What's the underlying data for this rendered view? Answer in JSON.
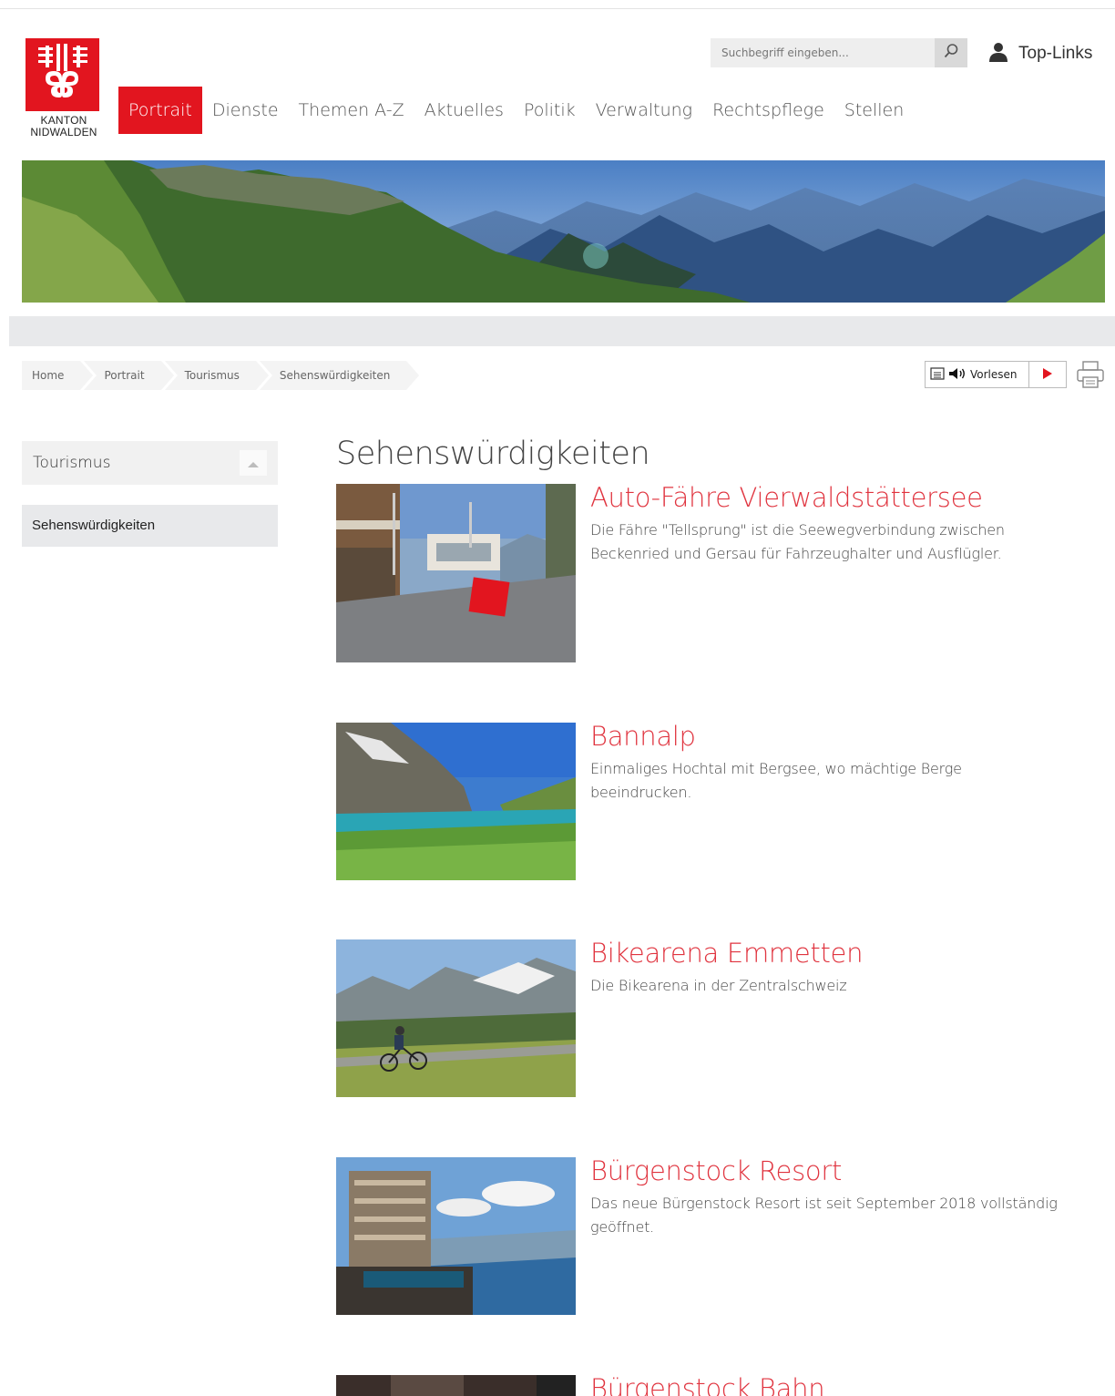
{
  "site": {
    "logo_line1": "KANTON",
    "logo_line2": "NIDWALDEN",
    "brand_color": "#e2151f"
  },
  "search": {
    "placeholder": "Suchbegriff eingeben..."
  },
  "toplinks": {
    "label": "Top-Links"
  },
  "nav": {
    "items": [
      {
        "label": "Portrait",
        "active": true
      },
      {
        "label": "Dienste"
      },
      {
        "label": "Themen A-Z"
      },
      {
        "label": "Aktuelles"
      },
      {
        "label": "Politik"
      },
      {
        "label": "Verwaltung"
      },
      {
        "label": "Rechtspflege"
      },
      {
        "label": "Stellen"
      }
    ]
  },
  "breadcrumb": [
    "Home",
    "Portrait",
    "Tourismus",
    "Sehenswürdigkeiten"
  ],
  "readspeaker": {
    "label": "Vorlesen"
  },
  "sidebar": {
    "heading": "Tourismus",
    "items": [
      {
        "label": "Sehenswürdigkeiten"
      }
    ]
  },
  "main": {
    "title": "Sehenswürdigkeiten",
    "teasers": [
      {
        "title": "Auto-Fähre Vierwaldstättersee",
        "text": "Die Fähre \"Tellsprung\" ist die Seewegverbindung zwischen Beckenried und Gersau für Fahrzeughalter und Ausflügler."
      },
      {
        "title": "Bannalp",
        "text": "Einmaliges Hochtal mit Bergsee, wo mächtige Berge beeindrucken."
      },
      {
        "title": "Bikearena Emmetten",
        "text": "Die Bikearena in der Zentralschweiz"
      },
      {
        "title": "Bürgenstock Resort",
        "text": "Das neue Bürgenstock Resort ist seit September 2018 vollständig geöffnet."
      },
      {
        "title": "Bürgenstock Bahn",
        "text": ""
      }
    ]
  }
}
